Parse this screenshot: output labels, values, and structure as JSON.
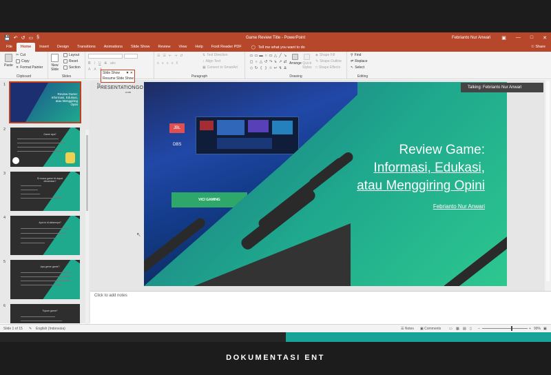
{
  "window": {
    "title": "Game Review Title  -  PowerPoint",
    "user": "Febrianto Nur Anwari",
    "qat_icons": [
      "save-icon",
      "undo-icon",
      "redo-icon",
      "start-slideshow-icon"
    ],
    "qat_extra": "§",
    "min": "—",
    "max": "□",
    "close": "✕",
    "ribbon_display": "▣"
  },
  "tabs": [
    "File",
    "Home",
    "Insert",
    "Design",
    "Transitions",
    "Animations",
    "Slide Show",
    "Review",
    "View",
    "Help",
    "Foxit Reader PDF"
  ],
  "active_tab": "Home",
  "tellme": "Tell me what you want to do",
  "share": "Share",
  "ribbon": {
    "clipboard": {
      "label": "Clipboard",
      "paste": "Paste",
      "cut": "Cut",
      "copy": "Copy",
      "format_painter": "Format Painter"
    },
    "slides": {
      "label": "Slides",
      "new_slide": "New\nSlide",
      "layout": "Layout",
      "reset": "Reset",
      "section": "Section"
    },
    "font": {
      "label": "",
      "bold": "B",
      "italic": "I",
      "underline": "U",
      "strike": "S",
      "shadow": "abc"
    },
    "paragraph": {
      "label": "Paragraph",
      "text_direction": "Text Direction",
      "align_text": "Align Text",
      "convert": "Convert to SmartArt"
    },
    "drawing": {
      "label": "Drawing",
      "arrange": "Arrange",
      "quick_styles": "Quick\nStyles",
      "fill": "Shape Fill",
      "outline": "Shape Outline",
      "effects": "Shape Effects"
    },
    "editing": {
      "label": "Editing",
      "find": "Find",
      "replace": "Replace",
      "select": "Select"
    }
  },
  "tooltip": {
    "line1": "Slide Show",
    "line2": "Resume Slide Show"
  },
  "talking": "Talking: Febrianto Nur Anwari",
  "thumb_numbers": [
    "1",
    "2",
    "3",
    "4",
    "5",
    "6"
  ],
  "thumb_titles": [
    "Review Game: Informasi, Edukasi, atau Menggiring Opini",
    "Game apa?",
    "Di mana game ini dapat dimainkan?",
    "Apa isi di dalamnya?",
    "Apa genre game?",
    "Tujuan game?"
  ],
  "slide": {
    "logo": "PRESENTATIONGO",
    "logo_by": "By",
    "logo_com": ".com",
    "title_lines": [
      "Review Game:",
      "Informasi, Edukasi,",
      "atau Menggiring Opini"
    ],
    "subtitle": "Febrianto Nur Anwari",
    "photo_text": "VICI GAMING"
  },
  "notes_placeholder": "Click to add notes",
  "status": {
    "slide_of": "Slide 1 of 15",
    "language": "English (Indonesia)",
    "notes": "Notes",
    "comments": "Comments",
    "zoom": "99%"
  },
  "caption": "DOKUMENTASI ENT"
}
